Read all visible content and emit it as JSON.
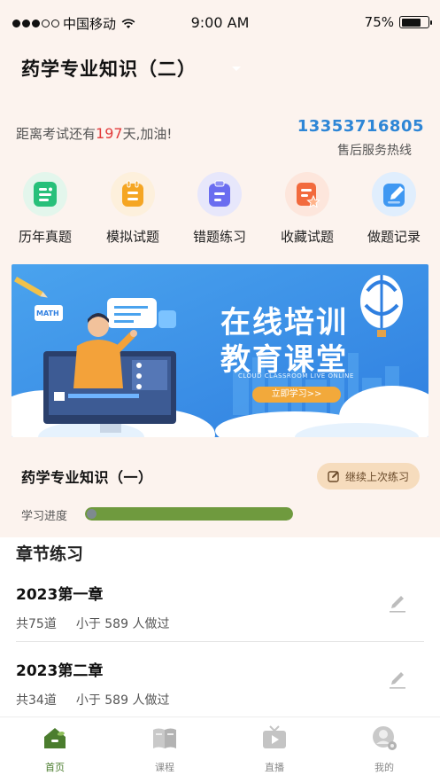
{
  "status_bar": {
    "carrier": "中国移动",
    "time": "9:00 AM",
    "battery": "75%",
    "battery_level": 0.75
  },
  "header": {
    "title": "药学专业知识（二）"
  },
  "countdown": {
    "prefix": "距离考试还有",
    "days": "197",
    "suffix": "天,加油!"
  },
  "hotline": {
    "phone": "13353716805",
    "label": "售后服务热线"
  },
  "quick_nav": [
    {
      "label": "历年真题",
      "icon": "exam-paper-icon",
      "color": "#27c07a"
    },
    {
      "label": "模拟试题",
      "icon": "clipboard-icon",
      "color": "#f5a623"
    },
    {
      "label": "错题练习",
      "icon": "wrong-question-icon",
      "color": "#6a6df0"
    },
    {
      "label": "收藏试题",
      "icon": "favorite-icon",
      "color": "#f26a3d"
    },
    {
      "label": "做题记录",
      "icon": "record-edit-icon",
      "color": "#3f98f2"
    }
  ],
  "banner": {
    "title_line1": "在线培训",
    "title_line2": "教育课堂",
    "subtitle": "CLOUD CLASSROOM LIVE ONLINE",
    "button": "立即学习>>",
    "badge": "MATH"
  },
  "current_course": {
    "name": "药学专业知识（一）",
    "continue_label": "继续上次练习"
  },
  "progress": {
    "label": "学习进度",
    "value": 1.0
  },
  "section": {
    "title": "章节练习"
  },
  "chapters": [
    {
      "name": "2023第一章",
      "count": "共75道",
      "done": "小于 589 人做过"
    },
    {
      "name": "2023第二章",
      "count": "共34道",
      "done": "小于 589 人做过"
    }
  ],
  "tabs": [
    {
      "label": "首页",
      "icon": "home-icon",
      "active": true
    },
    {
      "label": "课程",
      "icon": "book-icon",
      "active": false
    },
    {
      "label": "直播",
      "icon": "tv-icon",
      "active": false
    },
    {
      "label": "我的",
      "icon": "profile-icon",
      "active": false
    }
  ],
  "colors": {
    "accent": "#4b7d2e",
    "phone": "#2e86d6",
    "countdown": "#e23b3b",
    "progress": "#6f9a3e"
  }
}
